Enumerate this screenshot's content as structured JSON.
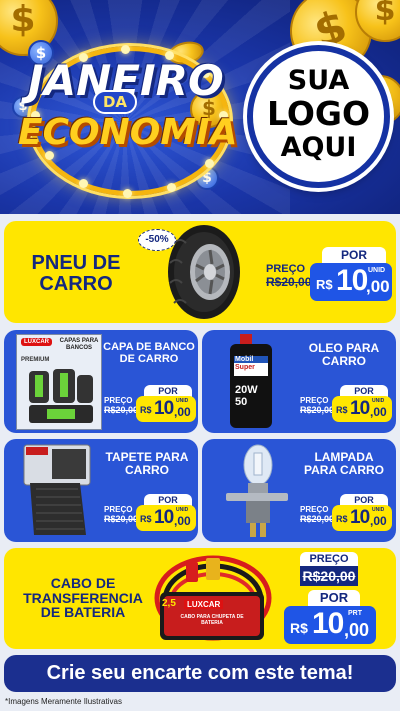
{
  "header": {
    "title_line1": "JANEIRO",
    "title_da": "DA",
    "title_line2": "ECONOMIA",
    "coin_symbol": "$",
    "logo": {
      "line1": "SUA",
      "line2": "LOGO",
      "line3": "AQUI"
    }
  },
  "products": [
    {
      "name_line1": "PNEU DE",
      "name_line2": "CARRO",
      "discount": "-50%",
      "old_label": "PREÇO",
      "old_price": "R$20,00",
      "por": "POR",
      "currency": "R$",
      "price_int": "10",
      "price_cents": ",00",
      "unit": "UNID",
      "image": "tire"
    },
    {
      "name_line1": "CAPA DE BANCO",
      "name_line2": "DE CARRO",
      "old_label": "PREÇO",
      "old_price": "R$20,00",
      "por": "POR",
      "currency": "R$",
      "price_int": "10",
      "price_cents": ",00",
      "unit": "UNID",
      "image": "seat-cover",
      "package_brand": "LUXCAR",
      "package_text": "CAPAS PARA BANCOS",
      "package_line": "PREMIUM"
    },
    {
      "name_line1": "OLEO PARA",
      "name_line2": "CARRO",
      "old_label": "PREÇO",
      "old_price": "R$20,00",
      "por": "POR",
      "currency": "R$",
      "price_int": "10",
      "price_cents": ",00",
      "unit": "UNID",
      "image": "oil-bottle",
      "bottle_brand1": "Mobil",
      "bottle_brand2": "Super",
      "bottle_grade1": "20W",
      "bottle_grade2": "50"
    },
    {
      "name_line1": "TAPETE PARA",
      "name_line2": "CARRO",
      "old_label": "PREÇO",
      "old_price": "R$20,00",
      "por": "POR",
      "currency": "R$",
      "price_int": "10",
      "price_cents": ",00",
      "unit": "UNID",
      "image": "floor-mat"
    },
    {
      "name_line1": "LAMPADA",
      "name_line2": "PARA CARRO",
      "old_label": "PREÇO",
      "old_price": "R$20,00",
      "por": "POR",
      "currency": "R$",
      "price_int": "10",
      "price_cents": ",00",
      "unit": "UNID",
      "image": "headlight-bulb"
    },
    {
      "name_line1": "CABO DE",
      "name_line2": "TRANSFERENCIA",
      "name_line3": "DE BATERIA",
      "old_label": "PREÇO",
      "old_price": "R$20,00",
      "por": "POR",
      "currency": "R$",
      "price_int": "10",
      "price_cents": ",00",
      "unit": "PRT",
      "image": "jumper-cables",
      "package_brand": "LUXCAR",
      "package_size": "2,5",
      "package_text": "CABO PARA CHUPETA DE BATERIA"
    }
  ],
  "footer": {
    "cta": "Crie seu encarte com este tema!",
    "disclaimer": "*Imagens Meramente Ilustrativas"
  },
  "colors": {
    "yellow": "#ffe600",
    "blue": "#2a55d6",
    "navy": "#14287f",
    "price_blue": "#1f55e6"
  }
}
